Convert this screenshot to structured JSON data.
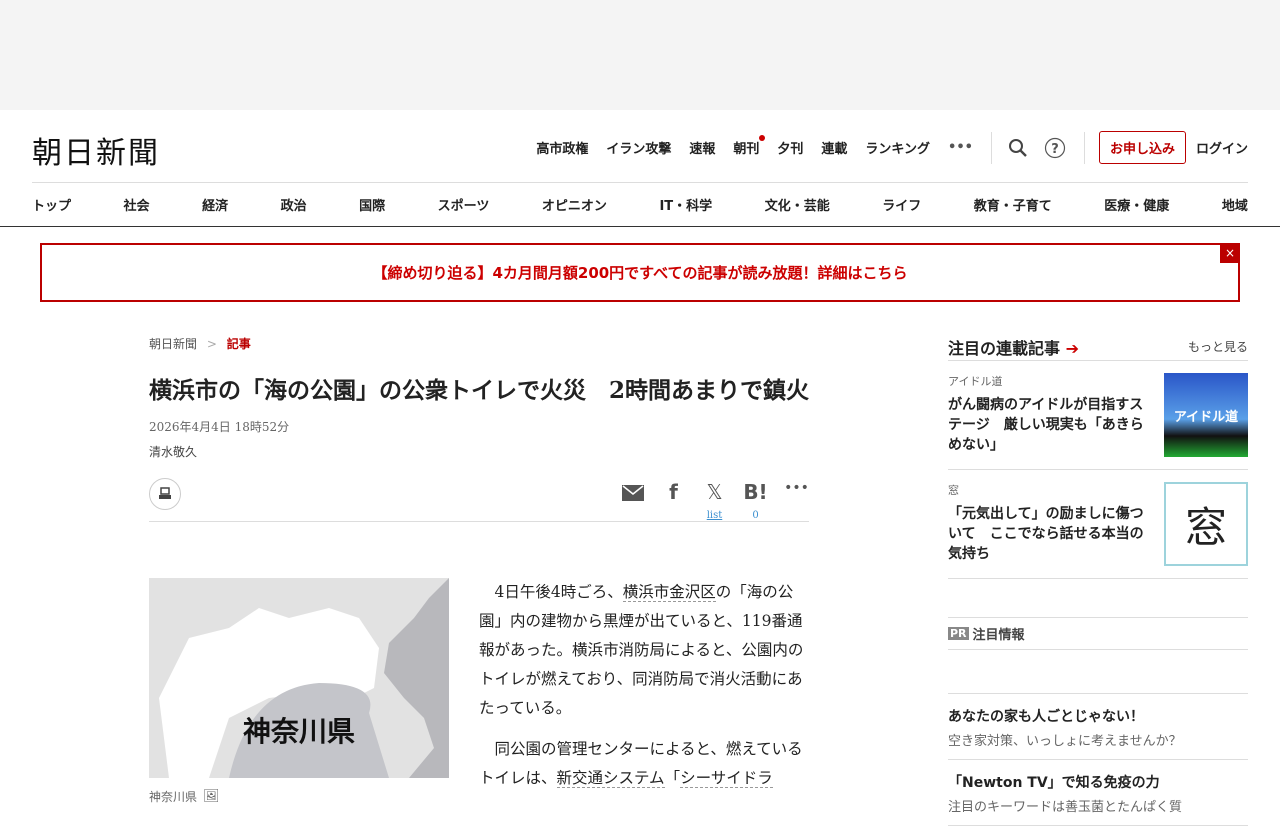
{
  "header": {
    "logo": "朝日新聞",
    "util_links": [
      "高市政権",
      "イラン攻撃",
      "速報",
      "朝刊",
      "夕刊",
      "連載",
      "ランキング"
    ],
    "more": "•••",
    "apply": "お申し込み",
    "login": "ログイン"
  },
  "nav": [
    "トップ",
    "社会",
    "経済",
    "政治",
    "国際",
    "スポーツ",
    "オピニオン",
    "IT・科学",
    "文化・芸能",
    "ライフ",
    "教育・子育て",
    "医療・健康",
    "地域"
  ],
  "banner": {
    "text": "【締め切り迫る】4カ月間月額200円ですべての記事が読み放題！詳細はこちら",
    "close": "×"
  },
  "article": {
    "breadcrumb": [
      "朝日新聞",
      ">",
      "記事"
    ],
    "title": "横浜市の「海の公園」の公衆トイレで火災　2時間あまりで鎮火",
    "date": "2026年4月4日 18時52分",
    "author": "清水敬久",
    "share": {
      "x_label": "list",
      "hatena_count": "0"
    },
    "figure": {
      "map_label": "神奈川県",
      "caption": "神奈川県"
    },
    "p1": [
      "4日午後4時ごろ、",
      "横浜市金沢区",
      "の「海の公園」内の建物から黒煙が出ていると、119番通報があった。横浜市消防局によると、公園内のトイレが燃えており、同消防局で消火活動にあたっている。"
    ],
    "p2": [
      "同公園の管理センターによると、燃えているトイレは、",
      "新交通システム",
      "「",
      "シーサイドラ"
    ]
  },
  "sidebar": {
    "heading": "注目の連載記事",
    "more": "もっと見る",
    "cards": [
      {
        "category": "アイドル道",
        "headline": "がん闘病のアイドルが目指すステージ　厳しい現実も「あきらめない」",
        "thumb_text": "アイドル道"
      },
      {
        "category": "窓",
        "headline": "「元気出して」の励ましに傷ついて　ここでなら話せる本当の気持ち",
        "thumb_text": "窓"
      }
    ],
    "pr_tag": "PR",
    "pr_heading": "注目情報",
    "pr_items": [
      {
        "title": "あなたの家も人ごとじゃない！",
        "desc": "空き家対策、いっしょに考えませんか？"
      },
      {
        "title": "「Newton TV」で知る免疫の力",
        "desc": "注目のキーワードは善玉菌とたんぱく質"
      }
    ]
  }
}
